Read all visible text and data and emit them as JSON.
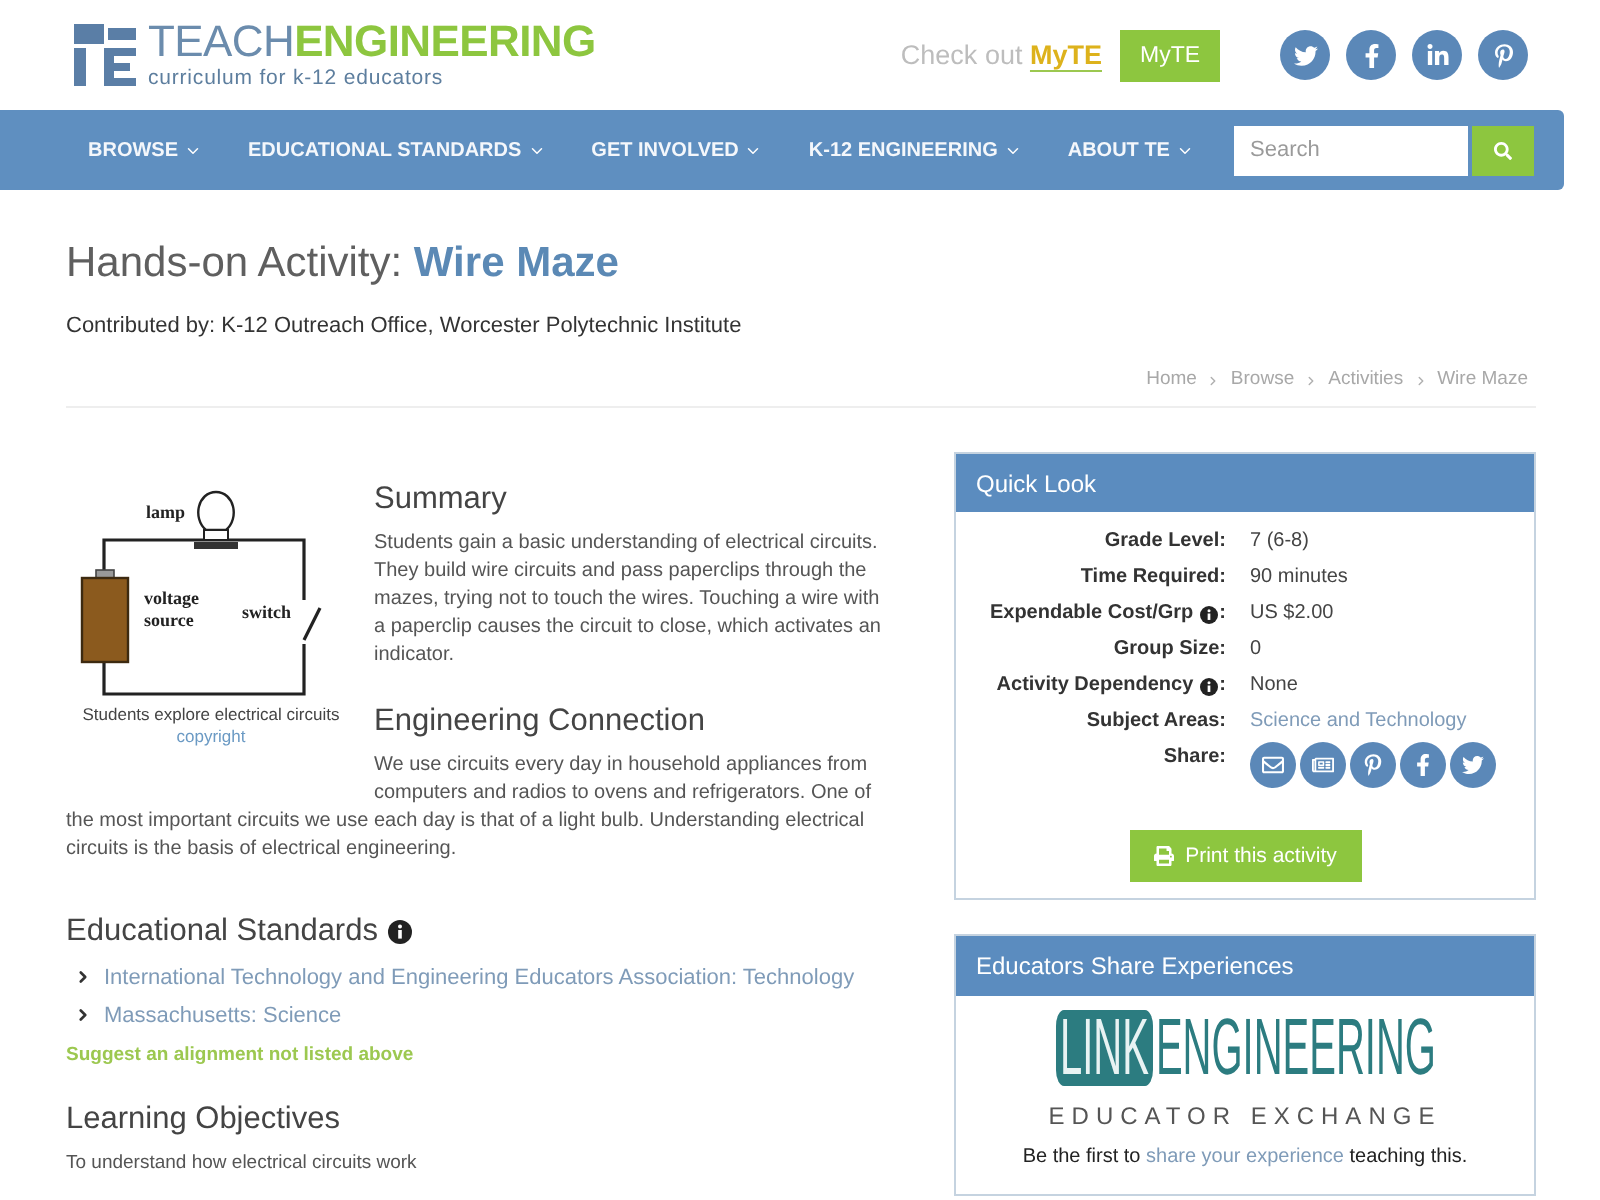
{
  "header": {
    "logo": {
      "word_light": "TEACH",
      "word_bold": "ENGINEERING",
      "tagline": "curriculum for k-12 educators"
    },
    "promo": {
      "text": "Check out",
      "brand": "MyTE"
    },
    "myte_button": "MyTE"
  },
  "nav": {
    "items": [
      {
        "label": "BROWSE"
      },
      {
        "label": "EDUCATIONAL STANDARDS"
      },
      {
        "label": "GET INVOLVED"
      },
      {
        "label": "K-12 ENGINEERING"
      },
      {
        "label": "ABOUT TE"
      }
    ],
    "search": {
      "placeholder": "Search"
    }
  },
  "page": {
    "type": "Hands-on Activity:",
    "title": "Wire Maze",
    "contributed": "Contributed by: K-12 Outreach Office, Worcester Polytechnic Institute",
    "breadcrumb": [
      "Home",
      "Browse",
      "Activities",
      "Wire Maze"
    ]
  },
  "figure": {
    "lamp_label": "lamp",
    "source_label": [
      "voltage",
      "source"
    ],
    "switch_label": "switch",
    "caption": "Students explore electrical circuits",
    "credit": "copyright"
  },
  "summary": {
    "heading": "Summary",
    "text": "Students gain a basic understanding of electrical circuits. They build wire circuits and pass paperclips through the mazes, trying not to touch the wires. Touching a wire with a paperclip causes the circuit to close, which activates an indicator."
  },
  "engineering_connection": {
    "heading": "Engineering Connection",
    "text": "We use circuits every day in household appliances from computers and radios to ovens and refrigerators. One of the most important circuits we use each day is that of a light bulb. Understanding electrical circuits is the basis of electrical engineering."
  },
  "standards": {
    "heading": "Educational Standards",
    "items": [
      "International Technology and Engineering Educators Association: Technology",
      "Massachusetts: Science"
    ],
    "suggest": "Suggest an alignment not listed above"
  },
  "objectives": {
    "heading": "Learning Objectives",
    "text": "To understand how electrical circuits work"
  },
  "quick_look": {
    "title": "Quick Look",
    "rows": [
      {
        "label": "Grade Level",
        "info": false,
        "colon": ":",
        "kind": "text",
        "value": "7 (6-8)"
      },
      {
        "label": "Time Required",
        "info": false,
        "colon": ":",
        "kind": "text",
        "value": "90 minutes"
      },
      {
        "label": "Expendable Cost/Grp",
        "info": true,
        "colon": ":",
        "kind": "text",
        "value": "US $2.00"
      },
      {
        "label": "Group Size",
        "info": false,
        "colon": ":",
        "kind": "text",
        "value": "0"
      },
      {
        "label": "Activity Dependency",
        "info": true,
        "colon": ":",
        "kind": "text",
        "value": "None"
      },
      {
        "label": "Subject Areas",
        "info": false,
        "colon": ":",
        "kind": "link",
        "value": "Science and Technology"
      },
      {
        "label": "Share",
        "info": false,
        "colon": ":",
        "kind": "share"
      }
    ],
    "print": "Print this activity"
  },
  "educators": {
    "title": "Educators Share Experiences",
    "logo": {
      "box": "LINK",
      "word": "ENGINEERING",
      "subtitle": "EDUCATOR EXCHANGE"
    },
    "text_before": "Be the first to",
    "link": "share your experience",
    "text_after": "teaching this."
  }
}
